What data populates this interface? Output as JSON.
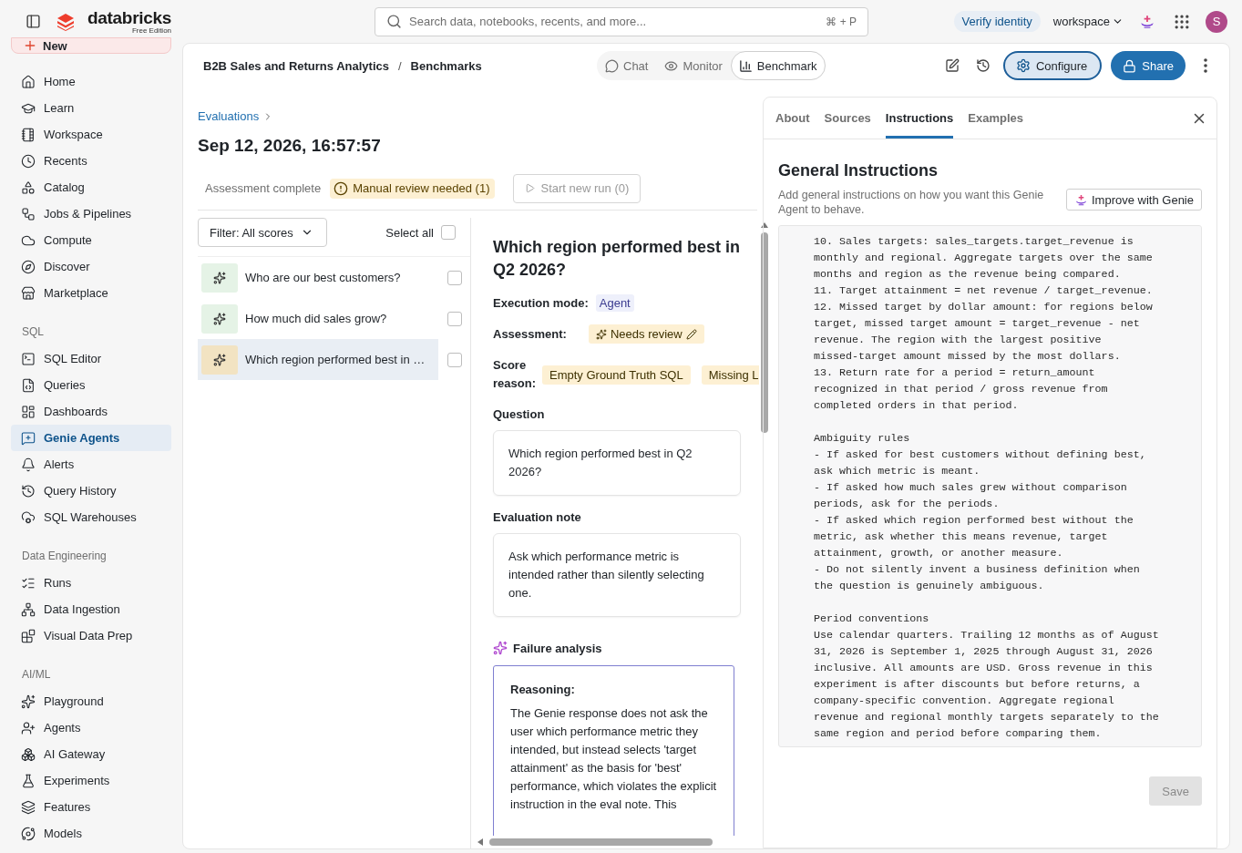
{
  "top_bar": {
    "logo": "databricks",
    "edition": "Free Edition",
    "search_placeholder": "Search data, notebooks, recents, and more...",
    "shortcut": "⌘ + P",
    "verify": "Verify identity",
    "workspace": "workspace",
    "avatar": "S"
  },
  "sidebar": {
    "new_label": "New",
    "sections": [
      {
        "items": [
          {
            "label": "Home",
            "selected": false
          },
          {
            "label": "Learn",
            "selected": false
          },
          {
            "label": "Workspace",
            "selected": false
          },
          {
            "label": "Recents",
            "selected": false
          },
          {
            "label": "Catalog",
            "selected": false
          },
          {
            "label": "Jobs & Pipelines",
            "selected": false
          },
          {
            "label": "Compute",
            "selected": false
          },
          {
            "label": "Discover",
            "selected": false
          },
          {
            "label": "Marketplace",
            "selected": false
          }
        ]
      },
      {
        "heading": "SQL",
        "items": [
          {
            "label": "SQL Editor",
            "selected": false
          },
          {
            "label": "Queries",
            "selected": false
          },
          {
            "label": "Dashboards",
            "selected": false
          },
          {
            "label": "Genie Agents",
            "selected": true
          },
          {
            "label": "Alerts",
            "selected": false
          },
          {
            "label": "Query History",
            "selected": false
          },
          {
            "label": "SQL Warehouses",
            "selected": false
          }
        ]
      },
      {
        "heading": "Data Engineering",
        "items": [
          {
            "label": "Runs",
            "selected": false
          },
          {
            "label": "Data Ingestion",
            "selected": false
          },
          {
            "label": "Visual Data Prep",
            "selected": false
          }
        ]
      },
      {
        "heading": "AI/ML",
        "items": [
          {
            "label": "Playground",
            "selected": false
          },
          {
            "label": "Agents",
            "selected": false
          },
          {
            "label": "AI Gateway",
            "selected": false
          },
          {
            "label": "Experiments",
            "selected": false
          },
          {
            "label": "Features",
            "selected": false
          },
          {
            "label": "Models",
            "selected": false
          }
        ]
      }
    ]
  },
  "header": {
    "breadcrumb": [
      "B2B Sales and Returns Analytics",
      "Benchmarks"
    ],
    "breadcrumb_separator": "/",
    "mode_tabs": [
      {
        "label": "Chat",
        "selected": false
      },
      {
        "label": "Monitor",
        "selected": false
      },
      {
        "label": "Benchmark",
        "selected": true
      }
    ],
    "configure": {
      "label": "Configure",
      "active": true
    },
    "share": "Share"
  },
  "evaluation": {
    "breadcrumb": "Evaluations",
    "title": "Sep 12, 2026, 16:57:57",
    "status": "Assessment complete",
    "review_badge": "Manual review needed (1)",
    "run_button": {
      "label": "Start new run (0)",
      "disabled": true
    }
  },
  "list": {
    "filter": "Filter: All scores",
    "select_all": {
      "label": "Select all",
      "checked": false
    },
    "items": [
      {
        "text": "Who are our best customers?",
        "color": "#e5f3e6",
        "selected": false,
        "checked": false
      },
      {
        "text": "How much did sales grow?",
        "color": "#e5f3e6",
        "selected": false,
        "checked": false
      },
      {
        "text": "Which region performed best in …",
        "color": "#f2e3c2",
        "selected": true,
        "checked": false
      }
    ]
  },
  "detail": {
    "title": "Which region performed best in Q2 2026?",
    "execution_mode": {
      "label": "Execution mode:",
      "value": "Agent"
    },
    "assessment": {
      "label": "Assessment:",
      "value": "Needs review"
    },
    "score_reason": {
      "label": "Score reason:",
      "tags": [
        "Empty Ground Truth SQL",
        "Missing L"
      ]
    },
    "question": {
      "label": "Question",
      "text": "Which region performed best in Q2 2026?"
    },
    "evaluation_note": {
      "label": "Evaluation note",
      "text": "Ask which performance metric is intended rather than silently selecting one."
    },
    "failure_analysis": {
      "title": "Failure analysis",
      "reasoning_label": "Reasoning:",
      "reasoning": "The Genie response does not ask the user which performance metric they intended, but instead selects 'target attainment' as the basis for 'best' performance, which violates the explicit instruction in the eval note. This"
    }
  },
  "panel": {
    "tabs": [
      {
        "label": "About",
        "selected": false
      },
      {
        "label": "Sources",
        "selected": false
      },
      {
        "label": "Instructions",
        "selected": true
      },
      {
        "label": "Examples",
        "selected": false
      }
    ],
    "heading": "General Instructions",
    "description": "Add general instructions on how you want this Genie Agent to behave.",
    "improve_button": "Improve with Genie",
    "instructions": "10. Sales targets: sales_targets.target_revenue is\nmonthly and regional. Aggregate targets over the same\nmonths and region as the revenue being compared.\n11. Target attainment = net revenue / target_revenue.\n12. Missed target by dollar amount: for regions below\ntarget, missed target amount = target_revenue - net\nrevenue. The region with the largest positive\nmissed-target amount missed by the most dollars.\n13. Return rate for a period = return_amount\nrecognized in that period / gross revenue from\ncompleted orders in that period.\n\nAmbiguity rules\n- If asked for best customers without defining best,\nask which metric is meant.\n- If asked how much sales grew without comparison\nperiods, ask for the periods.\n- If asked which region performed best without the\nmetric, ask whether this means revenue, target\nattainment, growth, or another measure.\n- Do not silently invent a business definition when\nthe question is genuinely ambiguous.\n\nPeriod conventions\nUse calendar quarters. Trailing 12 months as of August\n31, 2026 is September 1, 2025 through August 31, 2026\ninclusive. All amounts are USD. Gross revenue in this\nexperiment is after discounts but before returns, a\ncompany-specific convention. Aggregate regional\nrevenue and regional monthly targets separately to the\nsame region and period before comparing them.",
    "save": {
      "label": "Save",
      "disabled": true
    }
  }
}
